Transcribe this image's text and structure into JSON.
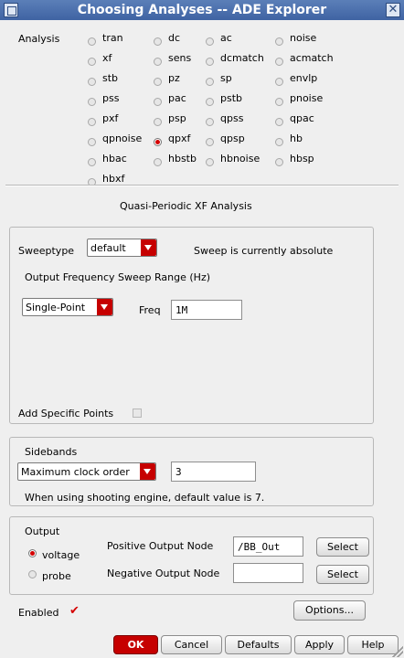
{
  "window": {
    "title": "Choosing Analyses -- ADE Explorer"
  },
  "analysis": {
    "label": "Analysis",
    "options": [
      "tran",
      "dc",
      "ac",
      "noise",
      "xf",
      "sens",
      "dcmatch",
      "acmatch",
      "stb",
      "pz",
      "sp",
      "envlp",
      "pss",
      "pac",
      "pstb",
      "pnoise",
      "pxf",
      "psp",
      "qpss",
      "qpac",
      "qpnoise",
      "qpxf",
      "qpsp",
      "hb",
      "hbac",
      "hbstb",
      "hbnoise",
      "hbsp",
      "hbxf"
    ],
    "selected": "qpxf"
  },
  "section_title": "Quasi-Periodic XF Analysis",
  "sweep": {
    "type_label": "Sweeptype",
    "type_value": "default",
    "status": "Sweep is currently absolute",
    "range_label": "Output Frequency Sweep Range (Hz)",
    "range_value": "Single-Point",
    "freq_label": "Freq",
    "freq_value": "1M",
    "add_points_label": "Add Specific Points"
  },
  "sidebands": {
    "label": "Sidebands",
    "mode_value": "Maximum clock order",
    "order_value": "3",
    "note": "When using shooting engine, default value is 7."
  },
  "output": {
    "label": "Output",
    "voltage_label": "voltage",
    "probe_label": "probe",
    "pos_label": "Positive Output Node",
    "pos_value": "/BB_Out",
    "neg_label": "Negative Output Node",
    "neg_value": "",
    "select_label": "Select"
  },
  "enabled_label": "Enabled",
  "buttons": {
    "options": "Options...",
    "ok": "OK",
    "cancel": "Cancel",
    "defaults": "Defaults",
    "apply": "Apply",
    "help": "Help"
  },
  "colors": {
    "accent": "#c60000",
    "title_bar": "#4a6eab"
  }
}
